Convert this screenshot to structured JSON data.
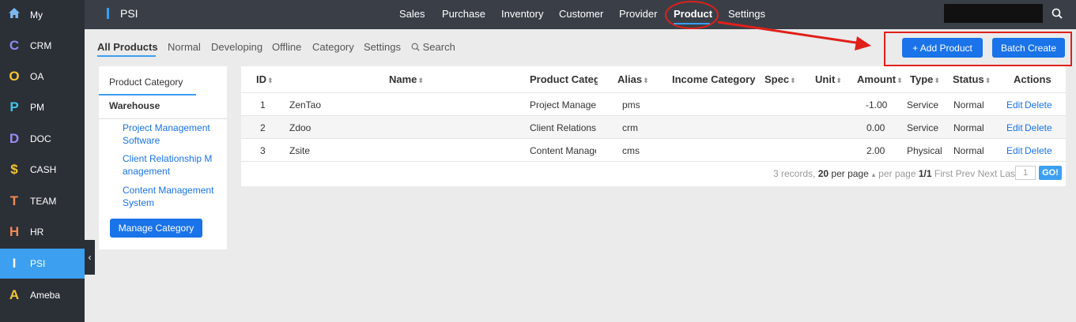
{
  "sidebar": {
    "items": [
      {
        "letter": "⌂",
        "label": "My",
        "color": "#7bb7f0"
      },
      {
        "letter": "C",
        "label": "CRM",
        "color": "#8a8cf0"
      },
      {
        "letter": "O",
        "label": "OA",
        "color": "#f3c534"
      },
      {
        "letter": "P",
        "label": "PM",
        "color": "#3fc6ee"
      },
      {
        "letter": "D",
        "label": "DOC",
        "color": "#9c8cf5"
      },
      {
        "letter": "$",
        "label": "CASH",
        "color": "#f3c534"
      },
      {
        "letter": "T",
        "label": "TEAM",
        "color": "#f08a56"
      },
      {
        "letter": "H",
        "label": "HR",
        "color": "#f08a56"
      },
      {
        "letter": "I",
        "label": "PSI",
        "color": "#ffffff"
      },
      {
        "letter": "A",
        "label": "Ameba",
        "color": "#f3c534"
      }
    ],
    "active_label": "PSI"
  },
  "header": {
    "app_title": "PSI",
    "nav": [
      "Sales",
      "Purchase",
      "Inventory",
      "Customer",
      "Provider",
      "Product",
      "Settings"
    ],
    "active_nav": "Product",
    "search_placeholder": ""
  },
  "subnav": {
    "items": [
      "All Products",
      "Normal",
      "Developing",
      "Offline",
      "Category",
      "Settings",
      "Search"
    ],
    "active": "All Products"
  },
  "actions": {
    "add_product": "+ Add Product",
    "batch_create": "Batch Create"
  },
  "category_panel": {
    "title": "Product Category",
    "warehouse": "Warehouse",
    "links": [
      "Project Management Software",
      "Client Relationship M anagement",
      "Content Management System"
    ],
    "manage_button": "Manage Category"
  },
  "table": {
    "headers": {
      "id": "ID",
      "name": "Name",
      "category": "Product Categ",
      "alias": "Alias",
      "income": "Income Category",
      "spec": "Spec",
      "unit": "Unit",
      "amount": "Amount",
      "type": "Type",
      "status": "Status",
      "actions": "Actions"
    },
    "rows": [
      {
        "id": "1",
        "name": "ZenTao",
        "category": "Project Manage",
        "alias": "pms",
        "amount": "-1.00",
        "type": "Service",
        "status": "Normal",
        "edit": "Edit",
        "delete": "Delete"
      },
      {
        "id": "2",
        "name": "Zdoo",
        "category": "Client Relations",
        "alias": "crm",
        "amount": "0.00",
        "type": "Service",
        "status": "Normal",
        "edit": "Edit",
        "delete": "Delete"
      },
      {
        "id": "3",
        "name": "Zsite",
        "category": "Content Manage",
        "alias": "cms",
        "amount": "2.00",
        "type": "Physical",
        "status": "Normal",
        "edit": "Edit",
        "delete": "Delete"
      }
    ]
  },
  "pager": {
    "records": "3 records,",
    "per_page_count": "20",
    "per_page_label": "per page",
    "per_page_label2": "per page",
    "page": "1/1",
    "first": "First",
    "prev": "Prev",
    "next": "Next",
    "last": "Last",
    "input_value": "1",
    "go": "GO!"
  },
  "colors": {
    "accent": "#3c9ff0",
    "button": "#1a73e8",
    "annotation": "#e0201b"
  }
}
